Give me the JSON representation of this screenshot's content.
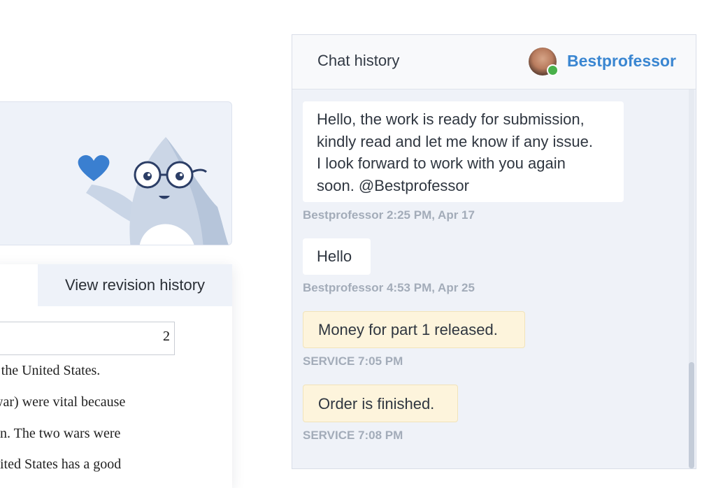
{
  "left_panel": {
    "revision_button_label": "View revision history",
    "page_number": "2",
    "document_lines": [
      "f the United States.",
      "war) were vital because",
      "on. The two wars were",
      "nited States has a good"
    ]
  },
  "chat": {
    "title": "Chat history",
    "agent_name": "Bestprofessor",
    "messages": [
      {
        "kind": "user",
        "text": "Hello, the work is ready for submission,\nkindly read and let me know if any issue.\nI look forward to work with you again\nsoon. @Bestprofessor",
        "meta": "Bestprofessor 2:25 PM, Apr 17"
      },
      {
        "kind": "user",
        "text": "Hello",
        "meta": "Bestprofessor 4:53 PM, Apr 25"
      },
      {
        "kind": "service",
        "text": "Money for part 1 released.",
        "meta": "SERVICE 7:05 PM"
      },
      {
        "kind": "service",
        "text": "Order is finished.",
        "meta": "SERVICE 7:08 PM"
      }
    ]
  },
  "colors": {
    "accent": "#3a86d1",
    "online": "#49b14a",
    "service_bubble": "#fdf4dc",
    "chat_background": "#eff2f8"
  }
}
